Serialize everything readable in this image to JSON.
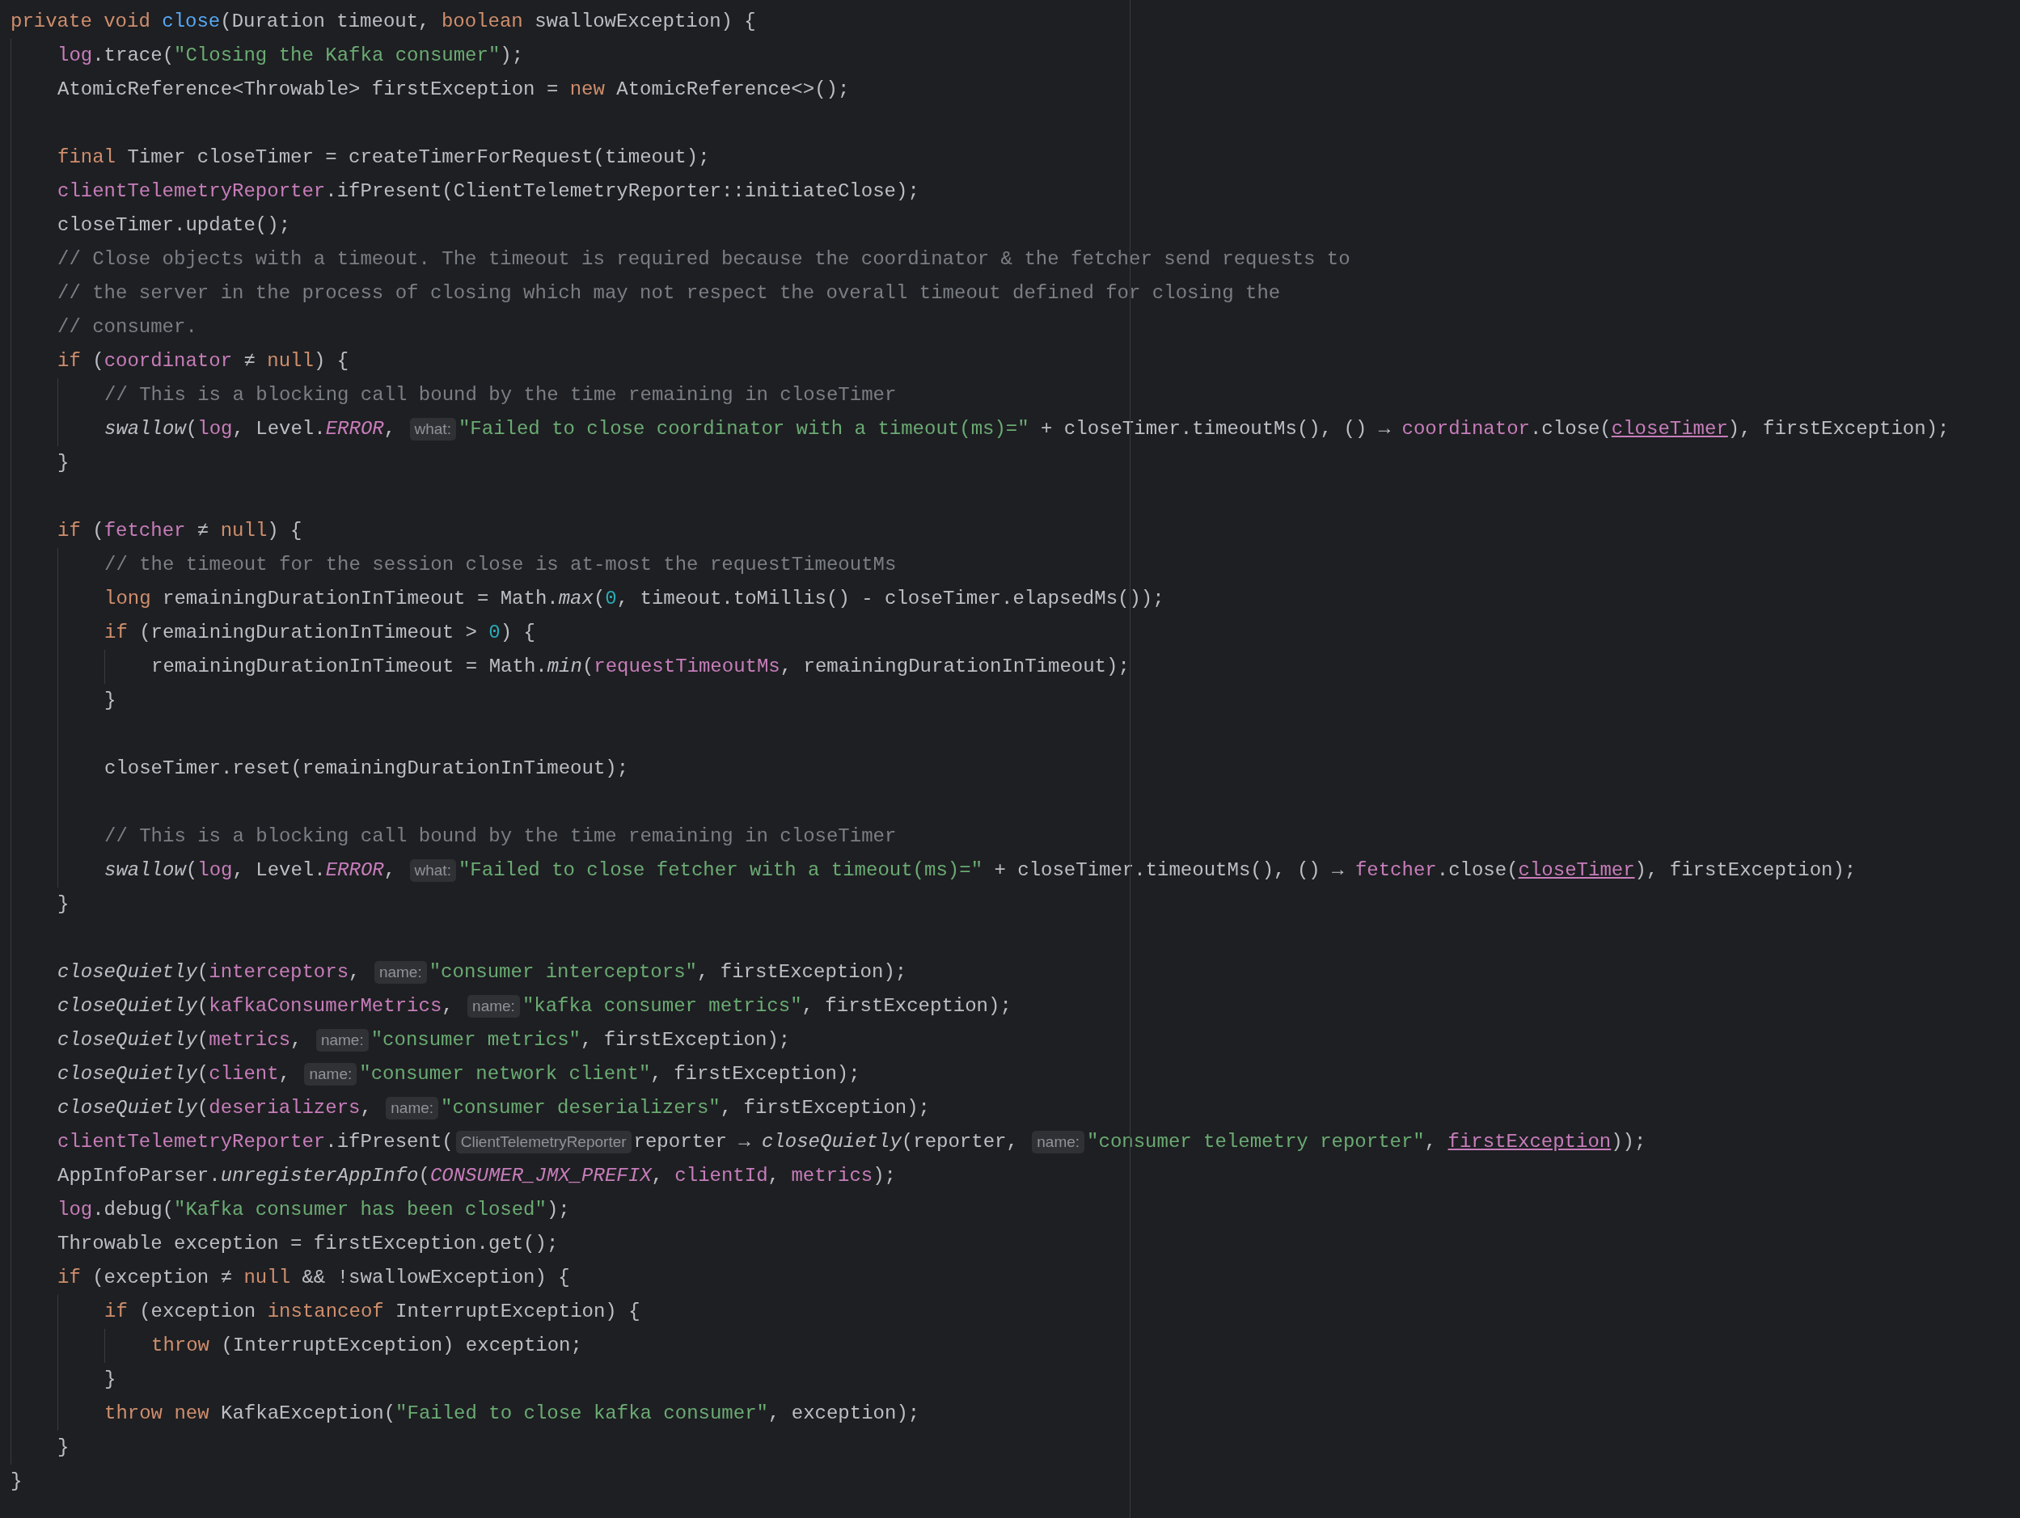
{
  "editor": {
    "lines": [
      {
        "kind": "code",
        "tokens": [
          {
            "kind": "keyword",
            "text": "private void "
          },
          {
            "kind": "declaration",
            "text": "close"
          },
          {
            "kind": "plain",
            "text": "(Duration timeout, "
          },
          {
            "kind": "keyword",
            "text": "boolean "
          },
          {
            "kind": "plain",
            "text": "swallowException) {"
          }
        ],
        "children": [
          {
            "kind": "code",
            "tokens": [
              {
                "kind": "field",
                "text": "log"
              },
              {
                "kind": "plain",
                "text": ".trace("
              },
              {
                "kind": "string",
                "text": "\"Closing the Kafka consumer\""
              },
              {
                "kind": "plain",
                "text": ");"
              }
            ]
          },
          {
            "kind": "code",
            "tokens": [
              {
                "kind": "plain",
                "text": "AtomicReference<Throwable> firstException = "
              },
              {
                "kind": "keyword",
                "text": "new "
              },
              {
                "kind": "plain",
                "text": "AtomicReference<>();"
              }
            ]
          },
          {
            "kind": "blank"
          },
          {
            "kind": "code",
            "tokens": [
              {
                "kind": "keyword",
                "text": "final "
              },
              {
                "kind": "plain",
                "text": "Timer closeTimer = createTimerForRequest(timeout);"
              }
            ]
          },
          {
            "kind": "code",
            "tokens": [
              {
                "kind": "field",
                "text": "clientTelemetryReporter"
              },
              {
                "kind": "plain",
                "text": ".ifPresent(ClientTelemetryReporter::initiateClose);"
              }
            ]
          },
          {
            "kind": "code",
            "tokens": [
              {
                "kind": "plain",
                "text": "closeTimer.update();"
              }
            ]
          },
          {
            "kind": "code",
            "tokens": [
              {
                "kind": "comment",
                "text": "// Close objects with a timeout. The timeout is required because the coordinator & the fetcher send requests to"
              }
            ]
          },
          {
            "kind": "code",
            "tokens": [
              {
                "kind": "comment",
                "text": "// the server in the process of closing which may not respect the overall timeout defined for closing the"
              }
            ]
          },
          {
            "kind": "code",
            "tokens": [
              {
                "kind": "comment",
                "text": "// consumer."
              }
            ]
          },
          {
            "kind": "code",
            "tokens": [
              {
                "kind": "keyword",
                "text": "if "
              },
              {
                "kind": "plain",
                "text": "("
              },
              {
                "kind": "field",
                "text": "coordinator"
              },
              {
                "kind": "plain",
                "text": " ≠ "
              },
              {
                "kind": "keyword",
                "text": "null"
              },
              {
                "kind": "plain",
                "text": ") {"
              }
            ],
            "children": [
              {
                "kind": "code",
                "tokens": [
                  {
                    "kind": "comment",
                    "text": "// This is a blocking call bound by the time remaining in closeTimer"
                  }
                ]
              },
              {
                "kind": "code",
                "tokens": [
                  {
                    "kind": "italic-method",
                    "text": "swallow"
                  },
                  {
                    "kind": "plain",
                    "text": "("
                  },
                  {
                    "kind": "field",
                    "text": "log"
                  },
                  {
                    "kind": "plain",
                    "text": ", Level."
                  },
                  {
                    "kind": "static-field",
                    "text": "ERROR"
                  },
                  {
                    "kind": "plain",
                    "text": ", "
                  },
                  {
                    "kind": "hint",
                    "text": "what:"
                  },
                  {
                    "kind": "string",
                    "text": "\"Failed to close coordinator with a timeout(ms)=\""
                  },
                  {
                    "kind": "plain",
                    "text": " + closeTimer.timeoutMs(), () → "
                  },
                  {
                    "kind": "field",
                    "text": "coordinator"
                  },
                  {
                    "kind": "plain",
                    "text": ".close("
                  },
                  {
                    "kind": "captured",
                    "text": "closeTimer"
                  },
                  {
                    "kind": "plain",
                    "text": "), firstException);"
                  }
                ]
              }
            ]
          },
          {
            "kind": "code",
            "tokens": [
              {
                "kind": "plain",
                "text": "}"
              }
            ]
          },
          {
            "kind": "blank"
          },
          {
            "kind": "code",
            "tokens": [
              {
                "kind": "keyword",
                "text": "if "
              },
              {
                "kind": "plain",
                "text": "("
              },
              {
                "kind": "field",
                "text": "fetcher"
              },
              {
                "kind": "plain",
                "text": " ≠ "
              },
              {
                "kind": "keyword",
                "text": "null"
              },
              {
                "kind": "plain",
                "text": ") {"
              }
            ],
            "children": [
              {
                "kind": "code",
                "tokens": [
                  {
                    "kind": "comment",
                    "text": "// the timeout for the session close is at-most the requestTimeoutMs"
                  }
                ]
              },
              {
                "kind": "code",
                "tokens": [
                  {
                    "kind": "keyword",
                    "text": "long "
                  },
                  {
                    "kind": "plain",
                    "text": "remainingDurationInTimeout = Math."
                  },
                  {
                    "kind": "italic-method",
                    "text": "max"
                  },
                  {
                    "kind": "plain",
                    "text": "("
                  },
                  {
                    "kind": "number",
                    "text": "0"
                  },
                  {
                    "kind": "plain",
                    "text": ", timeout.toMillis() - closeTimer.elapsedMs());"
                  }
                ]
              },
              {
                "kind": "code",
                "tokens": [
                  {
                    "kind": "keyword",
                    "text": "if "
                  },
                  {
                    "kind": "plain",
                    "text": "(remainingDurationInTimeout > "
                  },
                  {
                    "kind": "number",
                    "text": "0"
                  },
                  {
                    "kind": "plain",
                    "text": ") {"
                  }
                ],
                "children": [
                  {
                    "kind": "code",
                    "tokens": [
                      {
                        "kind": "plain",
                        "text": "remainingDurationInTimeout = Math."
                      },
                      {
                        "kind": "italic-method",
                        "text": "min"
                      },
                      {
                        "kind": "plain",
                        "text": "("
                      },
                      {
                        "kind": "field",
                        "text": "requestTimeoutMs"
                      },
                      {
                        "kind": "plain",
                        "text": ", remainingDurationInTimeout);"
                      }
                    ]
                  }
                ]
              },
              {
                "kind": "code",
                "tokens": [
                  {
                    "kind": "plain",
                    "text": "}"
                  }
                ]
              },
              {
                "kind": "blank"
              },
              {
                "kind": "code",
                "tokens": [
                  {
                    "kind": "plain",
                    "text": "closeTimer.reset(remainingDurationInTimeout);"
                  }
                ]
              },
              {
                "kind": "blank"
              },
              {
                "kind": "code",
                "tokens": [
                  {
                    "kind": "comment",
                    "text": "// This is a blocking call bound by the time remaining in closeTimer"
                  }
                ]
              },
              {
                "kind": "code",
                "tokens": [
                  {
                    "kind": "italic-method",
                    "text": "swallow"
                  },
                  {
                    "kind": "plain",
                    "text": "("
                  },
                  {
                    "kind": "field",
                    "text": "log"
                  },
                  {
                    "kind": "plain",
                    "text": ", Level."
                  },
                  {
                    "kind": "static-field",
                    "text": "ERROR"
                  },
                  {
                    "kind": "plain",
                    "text": ", "
                  },
                  {
                    "kind": "hint",
                    "text": "what:"
                  },
                  {
                    "kind": "string",
                    "text": "\"Failed to close fetcher with a timeout(ms)=\""
                  },
                  {
                    "kind": "plain",
                    "text": " + closeTimer.timeoutMs(), () → "
                  },
                  {
                    "kind": "field",
                    "text": "fetcher"
                  },
                  {
                    "kind": "plain",
                    "text": ".close("
                  },
                  {
                    "kind": "captured",
                    "text": "closeTimer"
                  },
                  {
                    "kind": "plain",
                    "text": "), firstException);"
                  }
                ]
              }
            ]
          },
          {
            "kind": "code",
            "tokens": [
              {
                "kind": "plain",
                "text": "}"
              }
            ]
          },
          {
            "kind": "blank"
          },
          {
            "kind": "code",
            "tokens": [
              {
                "kind": "italic-method",
                "text": "closeQuietly"
              },
              {
                "kind": "plain",
                "text": "("
              },
              {
                "kind": "field",
                "text": "interceptors"
              },
              {
                "kind": "plain",
                "text": ", "
              },
              {
                "kind": "hint",
                "text": "name:"
              },
              {
                "kind": "string",
                "text": "\"consumer interceptors\""
              },
              {
                "kind": "plain",
                "text": ", firstException);"
              }
            ]
          },
          {
            "kind": "code",
            "tokens": [
              {
                "kind": "italic-method",
                "text": "closeQuietly"
              },
              {
                "kind": "plain",
                "text": "("
              },
              {
                "kind": "field",
                "text": "kafkaConsumerMetrics"
              },
              {
                "kind": "plain",
                "text": ", "
              },
              {
                "kind": "hint",
                "text": "name:"
              },
              {
                "kind": "string",
                "text": "\"kafka consumer metrics\""
              },
              {
                "kind": "plain",
                "text": ", firstException);"
              }
            ]
          },
          {
            "kind": "code",
            "tokens": [
              {
                "kind": "italic-method",
                "text": "closeQuietly"
              },
              {
                "kind": "plain",
                "text": "("
              },
              {
                "kind": "field",
                "text": "metrics"
              },
              {
                "kind": "plain",
                "text": ", "
              },
              {
                "kind": "hint",
                "text": "name:"
              },
              {
                "kind": "string",
                "text": "\"consumer metrics\""
              },
              {
                "kind": "plain",
                "text": ", firstException);"
              }
            ]
          },
          {
            "kind": "code",
            "tokens": [
              {
                "kind": "italic-method",
                "text": "closeQuietly"
              },
              {
                "kind": "plain",
                "text": "("
              },
              {
                "kind": "field",
                "text": "client"
              },
              {
                "kind": "plain",
                "text": ", "
              },
              {
                "kind": "hint",
                "text": "name:"
              },
              {
                "kind": "string",
                "text": "\"consumer network client\""
              },
              {
                "kind": "plain",
                "text": ", firstException);"
              }
            ]
          },
          {
            "kind": "code",
            "tokens": [
              {
                "kind": "italic-method",
                "text": "closeQuietly"
              },
              {
                "kind": "plain",
                "text": "("
              },
              {
                "kind": "field",
                "text": "deserializers"
              },
              {
                "kind": "plain",
                "text": ", "
              },
              {
                "kind": "hint",
                "text": "name:"
              },
              {
                "kind": "string",
                "text": "\"consumer deserializers\""
              },
              {
                "kind": "plain",
                "text": ", firstException);"
              }
            ]
          },
          {
            "kind": "code",
            "tokens": [
              {
                "kind": "field",
                "text": "clientTelemetryReporter"
              },
              {
                "kind": "plain",
                "text": ".ifPresent("
              },
              {
                "kind": "hint",
                "text": "ClientTelemetryReporter"
              },
              {
                "kind": "plain",
                "text": "reporter → "
              },
              {
                "kind": "italic-method",
                "text": "closeQuietly"
              },
              {
                "kind": "plain",
                "text": "(reporter, "
              },
              {
                "kind": "hint",
                "text": "name:"
              },
              {
                "kind": "string",
                "text": "\"consumer telemetry reporter\""
              },
              {
                "kind": "plain",
                "text": ", "
              },
              {
                "kind": "captured",
                "text": "firstException"
              },
              {
                "kind": "plain",
                "text": "));"
              }
            ]
          },
          {
            "kind": "code",
            "tokens": [
              {
                "kind": "plain",
                "text": "AppInfoParser."
              },
              {
                "kind": "italic-method",
                "text": "unregisterAppInfo"
              },
              {
                "kind": "plain",
                "text": "("
              },
              {
                "kind": "static-field",
                "text": "CONSUMER_JMX_PREFIX"
              },
              {
                "kind": "plain",
                "text": ", "
              },
              {
                "kind": "field",
                "text": "clientId"
              },
              {
                "kind": "plain",
                "text": ", "
              },
              {
                "kind": "field",
                "text": "metrics"
              },
              {
                "kind": "plain",
                "text": ");"
              }
            ]
          },
          {
            "kind": "code",
            "tokens": [
              {
                "kind": "field",
                "text": "log"
              },
              {
                "kind": "plain",
                "text": ".debug("
              },
              {
                "kind": "string",
                "text": "\"Kafka consumer has been closed\""
              },
              {
                "kind": "plain",
                "text": ");"
              }
            ]
          },
          {
            "kind": "code",
            "tokens": [
              {
                "kind": "plain",
                "text": "Throwable exception = firstException.get();"
              }
            ]
          },
          {
            "kind": "code",
            "tokens": [
              {
                "kind": "keyword",
                "text": "if "
              },
              {
                "kind": "plain",
                "text": "(exception ≠ "
              },
              {
                "kind": "keyword",
                "text": "null"
              },
              {
                "kind": "plain",
                "text": " && !swallowException) {"
              }
            ],
            "children": [
              {
                "kind": "code",
                "tokens": [
                  {
                    "kind": "keyword",
                    "text": "if "
                  },
                  {
                    "kind": "plain",
                    "text": "(exception "
                  },
                  {
                    "kind": "keyword",
                    "text": "instanceof "
                  },
                  {
                    "kind": "plain",
                    "text": "InterruptException) {"
                  }
                ],
                "children": [
                  {
                    "kind": "code",
                    "tokens": [
                      {
                        "kind": "keyword",
                        "text": "throw "
                      },
                      {
                        "kind": "plain",
                        "text": "(InterruptException) exception;"
                      }
                    ]
                  }
                ]
              },
              {
                "kind": "code",
                "tokens": [
                  {
                    "kind": "plain",
                    "text": "}"
                  }
                ]
              },
              {
                "kind": "code",
                "tokens": [
                  {
                    "kind": "keyword",
                    "text": "throw new "
                  },
                  {
                    "kind": "plain",
                    "text": "KafkaException("
                  },
                  {
                    "kind": "string",
                    "text": "\"Failed to close kafka consumer\""
                  },
                  {
                    "kind": "plain",
                    "text": ", exception);"
                  }
                ]
              }
            ]
          },
          {
            "kind": "code",
            "tokens": [
              {
                "kind": "plain",
                "text": "}"
              }
            ]
          }
        ]
      },
      {
        "kind": "code",
        "tokens": [
          {
            "kind": "plain",
            "text": "}"
          }
        ]
      }
    ]
  }
}
